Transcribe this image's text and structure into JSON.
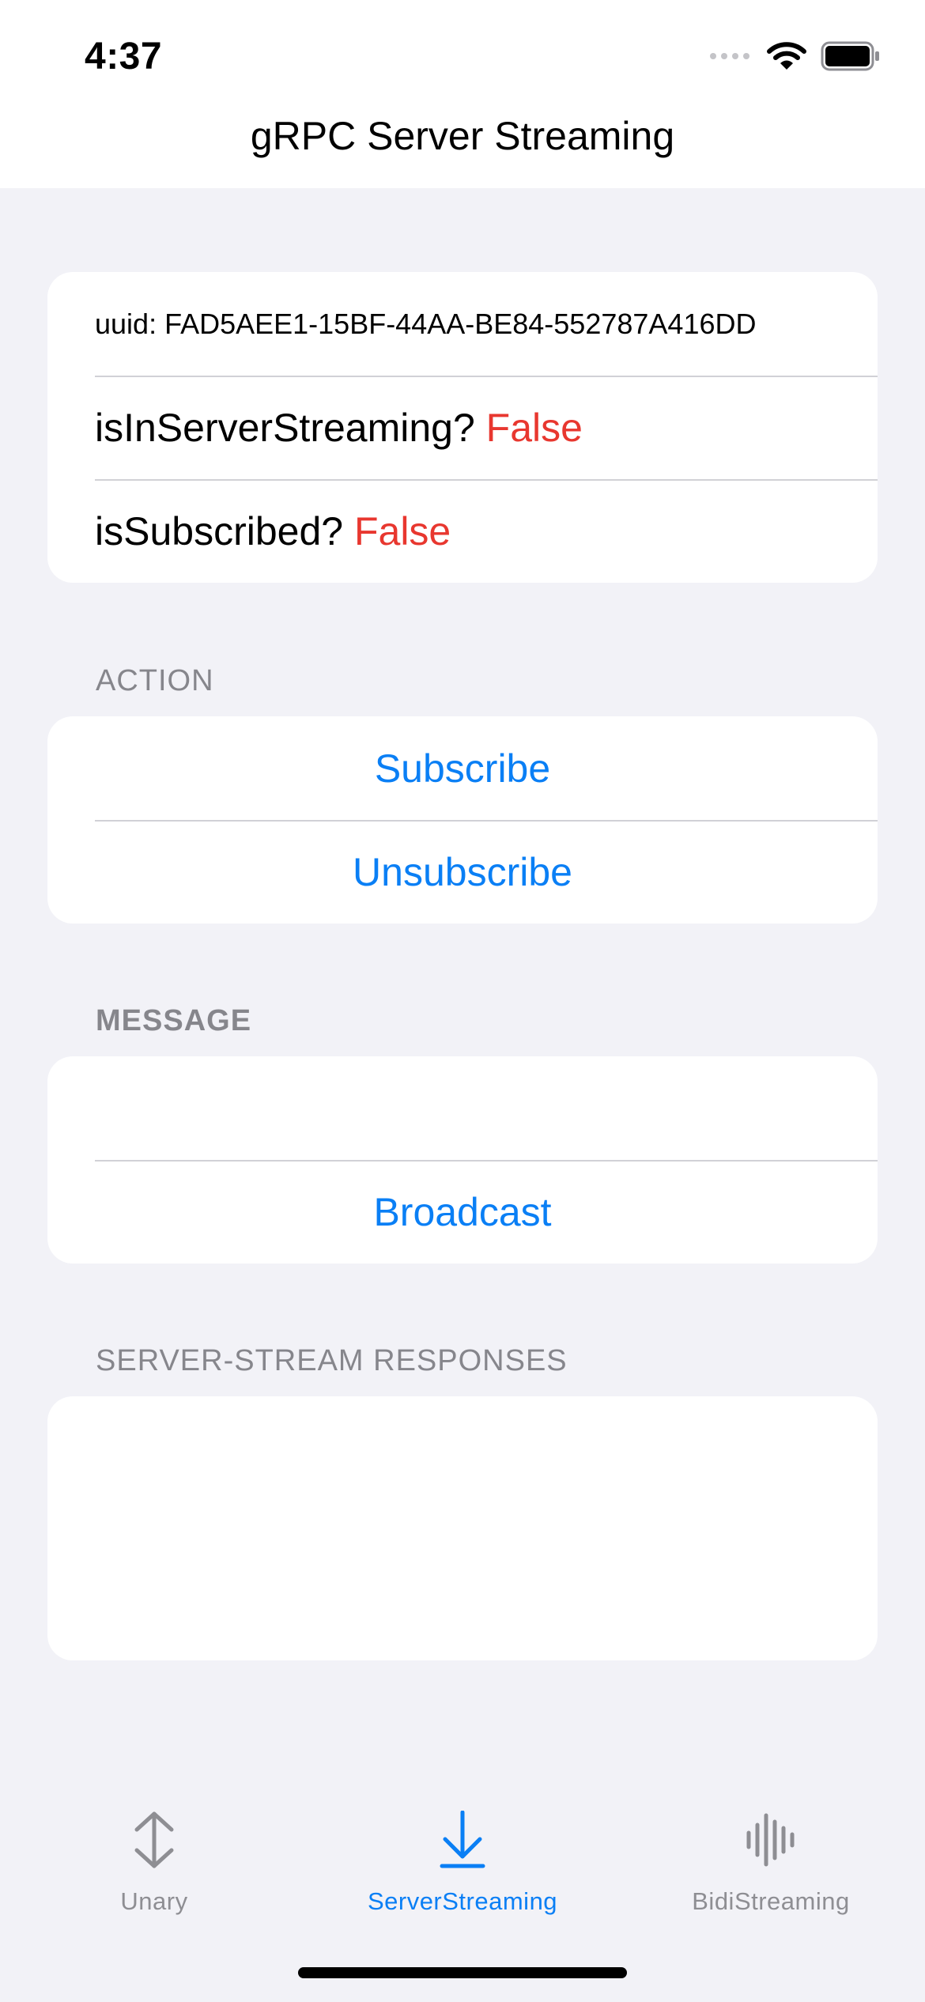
{
  "status_bar": {
    "time": "4:37",
    "icons": [
      "cellular-signal-icon",
      "wifi-icon",
      "battery-icon"
    ]
  },
  "nav": {
    "title": "gRPC Server Streaming"
  },
  "info": {
    "uuid_label": "uuid: FAD5AEE1-15BF-44AA-BE84-552787A416DD",
    "streaming_label": "isInServerStreaming?",
    "streaming_value": "False",
    "subscribed_label": "isSubscribed?",
    "subscribed_value": "False"
  },
  "action": {
    "header": "ACTION",
    "subscribe_label": "Subscribe",
    "unsubscribe_label": "Unsubscribe"
  },
  "message": {
    "header": "MESSAGE",
    "input_value": "",
    "input_placeholder": "",
    "broadcast_label": "Broadcast"
  },
  "responses": {
    "header": "SERVER-STREAM RESPONSES",
    "items": []
  },
  "tab_bar": {
    "tabs": [
      {
        "label": "Unary",
        "icon": "up-down-arrow-icon",
        "selected": false
      },
      {
        "label": "ServerStreaming",
        "icon": "download-arrow-icon",
        "selected": true
      },
      {
        "label": "BidiStreaming",
        "icon": "waveform-icon",
        "selected": false
      }
    ]
  },
  "colors": {
    "accent": "#0a7ff5",
    "false_value": "#e8372f",
    "background": "#f2f2f7",
    "inactive_tab": "#8e8e93"
  }
}
